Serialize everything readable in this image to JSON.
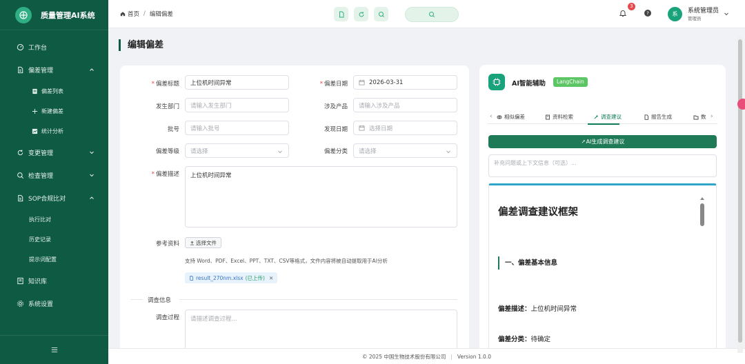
{
  "app": {
    "title": "质量管理AI系统"
  },
  "sidebar": {
    "items": [
      {
        "label": "工作台",
        "icon": "dashboard-icon"
      },
      {
        "label": "偏差管理",
        "icon": "document-icon",
        "expanded": true,
        "children": [
          {
            "label": "偏差列表",
            "icon": "list-icon"
          },
          {
            "label": "新建偏差",
            "icon": "plus-icon"
          },
          {
            "label": "统计分析",
            "icon": "chart-icon"
          }
        ]
      },
      {
        "label": "变更管理",
        "icon": "refresh-icon",
        "expanded": false
      },
      {
        "label": "检查管理",
        "icon": "search-icon",
        "expanded": false
      },
      {
        "label": "SOP合规比对",
        "icon": "document-icon",
        "expanded": true,
        "children": [
          {
            "label": "执行比对"
          },
          {
            "label": "历史记录"
          },
          {
            "label": "提示词配置"
          }
        ]
      },
      {
        "label": "知识库",
        "icon": "book-icon"
      },
      {
        "label": "系统设置",
        "icon": "gear-icon"
      }
    ]
  },
  "header": {
    "breadcrumb": {
      "home": "首页",
      "current": "编辑偏差"
    },
    "notifications": "3",
    "user": {
      "avatar": "系",
      "name": "系统管理员",
      "role": "管理员"
    }
  },
  "page": {
    "title": "编辑偏差"
  },
  "form": {
    "title_label": "偏差标题",
    "title_value": "上位机时间异常",
    "date_label": "偏差日期",
    "date_value": "2026-03-31",
    "dept_label": "发生部门",
    "dept_placeholder": "请输入发生部门",
    "product_label": "涉及产品",
    "product_placeholder": "请输入涉及产品",
    "batch_label": "批号",
    "batch_placeholder": "请输入批号",
    "found_date_label": "发现日期",
    "found_date_placeholder": "选择日期",
    "level_label": "偏差等级",
    "level_placeholder": "请选择",
    "category_label": "偏差分类",
    "category_placeholder": "请选择",
    "desc_label": "偏差描述",
    "desc_value": "上位机时间异常",
    "ref_label": "参考资料",
    "upload_button": "选择文件",
    "upload_hint": "支持 Word、PDF、Excel、PPT、TXT、CSV等格式，文件内容将被自动提取用于AI分析",
    "file_name": "result_270nm.xlsx",
    "file_status": "(已上传)",
    "section_investigation": "调查信息",
    "process_label": "调查过程",
    "process_placeholder": "请描述调查过程..."
  },
  "ai_panel": {
    "title": "AI智能辅助",
    "badge": "LangChain",
    "tabs": [
      {
        "label": "相似偏差",
        "icon": "link-icon"
      },
      {
        "label": "资料检索",
        "icon": "book-icon"
      },
      {
        "label": "调查建议",
        "icon": "bulb-icon",
        "active": true
      },
      {
        "label": "报告生成",
        "icon": "document-icon"
      },
      {
        "label": "数",
        "icon": "folder-icon"
      }
    ],
    "generate_button": "AI生成调查建议",
    "context_placeholder": "补充问题或上下文信息（可选）...",
    "result": {
      "h1": "偏差调查建议框架",
      "h2": "一、偏差基本信息",
      "line1_key": "偏差描述：",
      "line1_value": "上位机时间异常",
      "line2_key": "偏差分类：",
      "line2_value": "待确定"
    }
  },
  "footer": {
    "copyright": "© 2025 中国生物技术股份有限公司",
    "version": "Version 1.0.0"
  },
  "colors": {
    "sidebar": "#0f5a43",
    "accent": "#1f7a57",
    "badge": "#5cc564",
    "danger": "#e5484d"
  }
}
